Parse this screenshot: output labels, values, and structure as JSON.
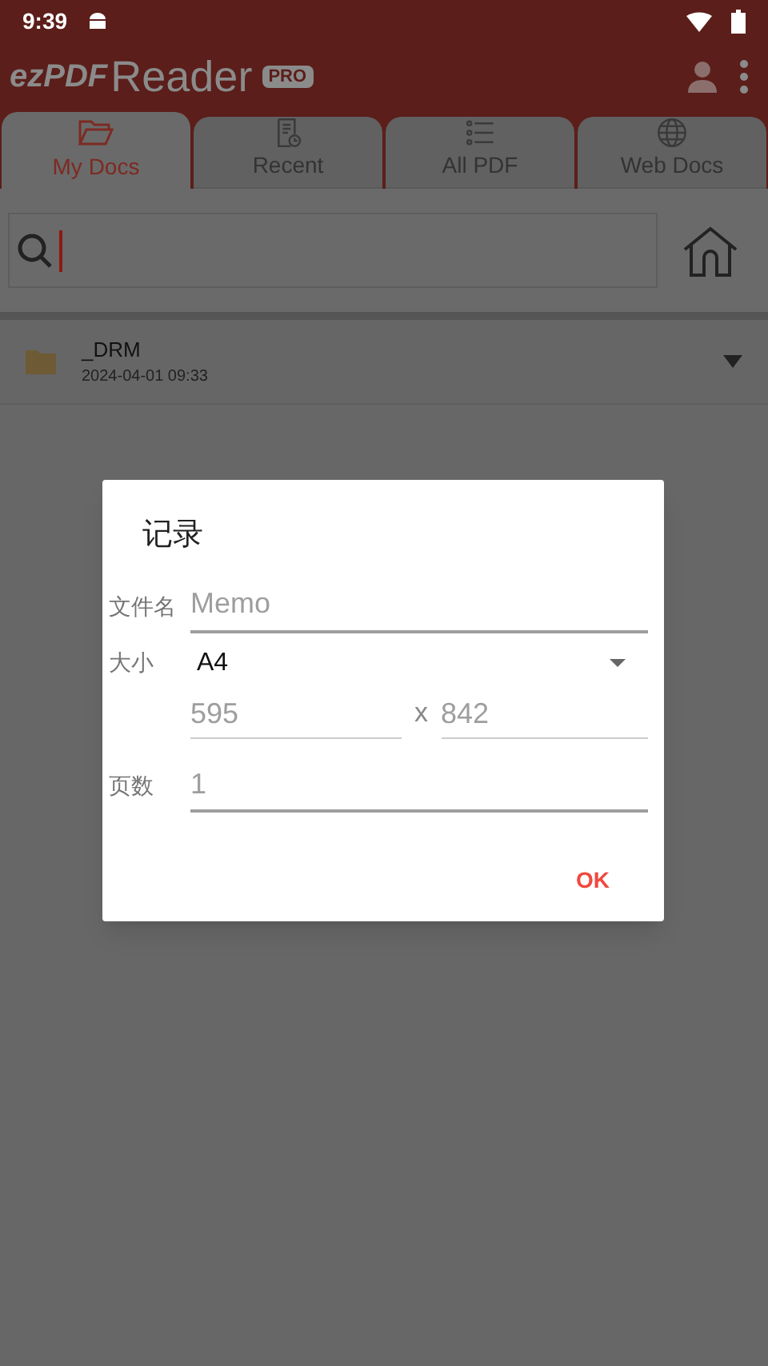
{
  "status_bar": {
    "time": "9:39"
  },
  "app_bar": {
    "logo": "ezPDF",
    "title": "Reader",
    "badge": "PRO"
  },
  "tabs": [
    {
      "label": "My Docs",
      "selected": true
    },
    {
      "label": "Recent",
      "selected": false
    },
    {
      "label": "All PDF",
      "selected": false
    },
    {
      "label": "Web Docs",
      "selected": false
    }
  ],
  "files": [
    {
      "name": "_DRM",
      "date": "2024-04-01 09:33"
    }
  ],
  "dialog": {
    "title": "记录",
    "filename": {
      "label": "文件名",
      "placeholder": "Memo"
    },
    "size": {
      "label": "大小",
      "value": "A4",
      "width_placeholder": "595",
      "separator": "x",
      "height_placeholder": "842"
    },
    "pages": {
      "label": "页数",
      "placeholder": "1"
    },
    "buttons": [
      "OK"
    ]
  }
}
